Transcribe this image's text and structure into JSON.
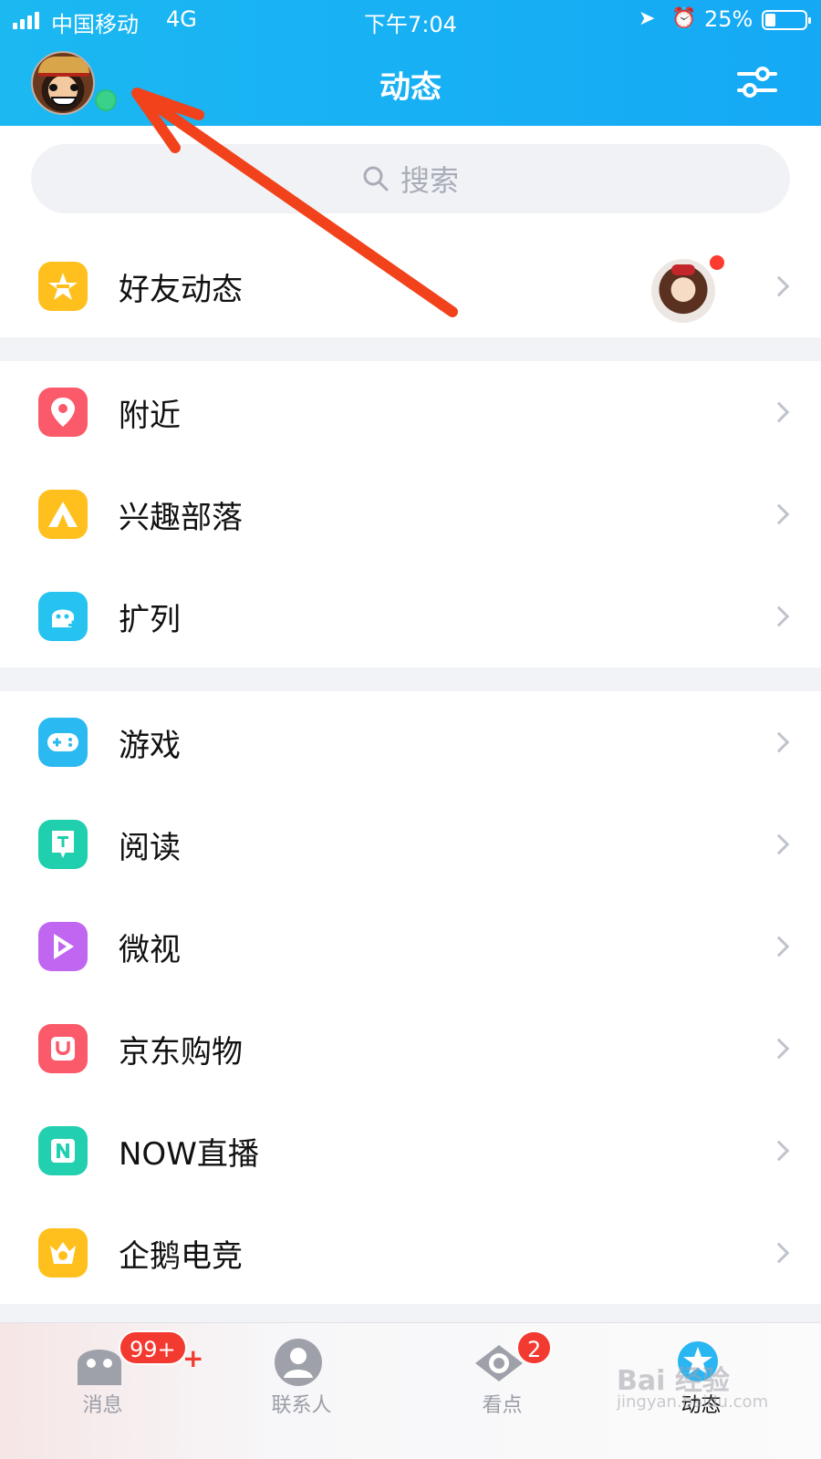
{
  "status_bar": {
    "carrier": "中国移动",
    "network": "4G",
    "time": "下午7:04",
    "battery": "25%",
    "battery_level": 0.25
  },
  "header": {
    "title": "动态",
    "settings_icon": "sliders-icon",
    "avatar_online": true
  },
  "search": {
    "placeholder": "搜索"
  },
  "groups": [
    {
      "items": [
        {
          "label": "好友动态",
          "icon": "qzone-star-icon",
          "color": "#ffc01e",
          "has_thumb": true,
          "has_dot": true
        }
      ]
    },
    {
      "items": [
        {
          "label": "附近",
          "icon": "location-pin-icon",
          "color": "#fb5a6a"
        },
        {
          "label": "兴趣部落",
          "icon": "tent-icon",
          "color": "#ffc01e"
        },
        {
          "label": "扩列",
          "icon": "ghost-add-icon",
          "color": "#27c3f0"
        }
      ]
    },
    {
      "items": [
        {
          "label": "游戏",
          "icon": "gamepad-icon",
          "color": "#2bb9f1"
        },
        {
          "label": "阅读",
          "icon": "bookmark-icon",
          "color": "#1fcfae"
        },
        {
          "label": "微视",
          "icon": "play-icon",
          "color": "#c066f0"
        },
        {
          "label": "京东购物",
          "icon": "shopping-bag-icon",
          "color": "#fb5a6a"
        },
        {
          "label": "NOW直播",
          "icon": "now-live-icon",
          "color": "#22d0b0"
        },
        {
          "label": "企鹅电竞",
          "icon": "esports-crown-icon",
          "color": "#ffc01e"
        }
      ]
    }
  ],
  "tabbar": {
    "tabs": [
      {
        "label": "消息",
        "icon": "message-ghost-icon",
        "badge": "99+"
      },
      {
        "label": "联系人",
        "icon": "contacts-icon",
        "badge": ""
      },
      {
        "label": "看点",
        "icon": "eye-icon",
        "badge": "2"
      },
      {
        "label": "动态",
        "icon": "star-planet-icon",
        "badge": "",
        "active": true
      }
    ]
  },
  "watermark": {
    "text": "Bai 经验",
    "sub": "jingyan.baidu.com"
  },
  "colors": {
    "header": "#15a9f5",
    "badge": "#f33a30",
    "online": "#3ad18a",
    "annotation_arrow": "#f2421b"
  }
}
